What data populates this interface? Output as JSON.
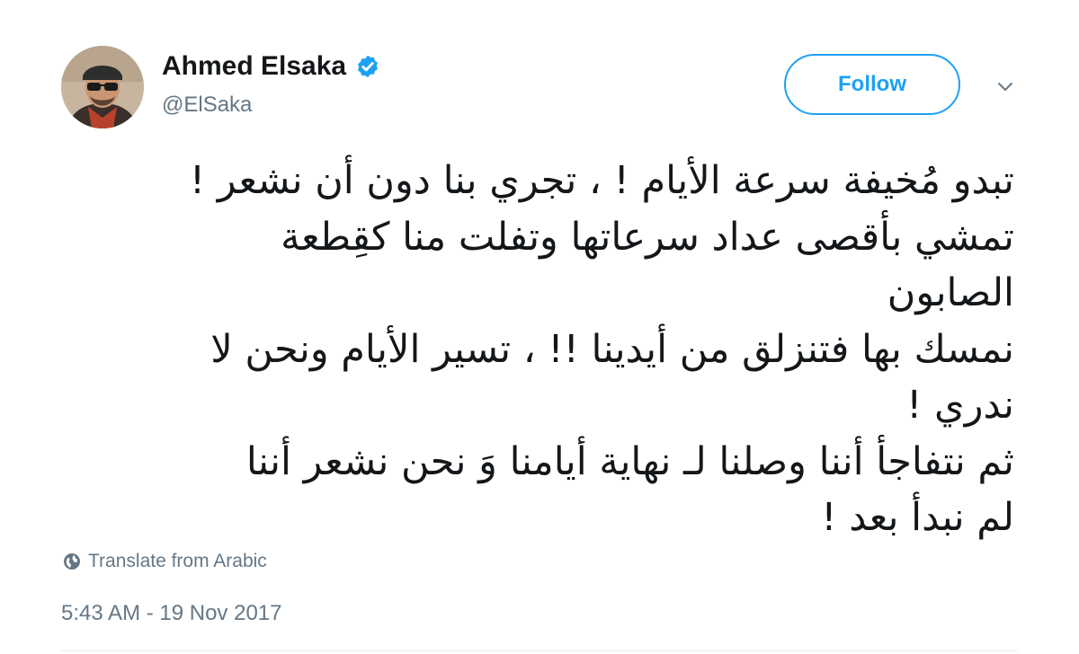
{
  "author": {
    "name": "Ahmed Elsaka",
    "handle": "@ElSaka",
    "verified": true
  },
  "follow_button": {
    "label": "Follow"
  },
  "menu": {
    "icon": "chevron-down-icon"
  },
  "tweet": {
    "lines": [
      "تبدو مُخيفة سرعة الأيام ! ، تجري بنا دون أن نشعر !",
      "تمشي بأقصى عداد سرعاتها وتفلت منا كقِطعة",
      "الصابون",
      "نمسك بها فتنزلق من أيدينا !! ، تسير الأيام ونحن لا",
      "ندري !",
      "ثم نتفاجأ أننا وصلنا لـ نهاية أيامنا وَ نحن نشعر أننا",
      "لم نبدأ بعد !"
    ]
  },
  "translate": {
    "label": "Translate from Arabic",
    "icon": "globe-icon"
  },
  "timestamp": "5:43 AM - 19 Nov 2017",
  "colors": {
    "accent": "#1da1f2",
    "text": "#14171a",
    "muted": "#657786"
  }
}
